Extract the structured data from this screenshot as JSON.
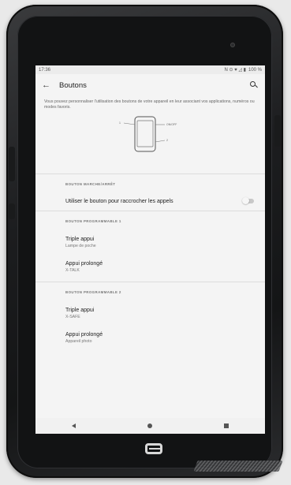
{
  "status_bar": {
    "time": "17:36",
    "icons": "N ⊙ ♥ ◿ ▮",
    "battery": "100 %"
  },
  "app_bar": {
    "back_icon": "←",
    "title": "Boutons",
    "search_icon": "search-icon"
  },
  "intro_text": "Vous pouvez personnaliser l'utilisation des boutons de votre appareil en leur associant vos applications, numéros ou modes favoris.",
  "illustration": {
    "label_left": "1",
    "label_right_top": "ON/OFF",
    "label_right_bottom": "2"
  },
  "sections": {
    "power": {
      "header": "BOUTON MARCHE/ARRÊT",
      "toggle_label": "Utiliser le bouton pour raccrocher les appels",
      "toggle_on": false
    },
    "prog1": {
      "header": "BOUTON PROGRAMMABLE 1",
      "triple_title": "Triple appui",
      "triple_value": "Lampe de poche",
      "long_title": "Appui prolongé",
      "long_value": "X-TALK"
    },
    "prog2": {
      "header": "BOUTON PROGRAMMABLE 2",
      "triple_title": "Triple appui",
      "triple_value": "X-SAFE",
      "long_title": "Appui prolongé",
      "long_value": "Appareil photo"
    }
  },
  "nav_bar": {
    "back": "nav-back-icon",
    "home": "nav-home-icon",
    "recents": "nav-recents-icon"
  },
  "colors": {
    "screen_bg": "#f4f4f4",
    "device_body": "#1c1d1f"
  }
}
